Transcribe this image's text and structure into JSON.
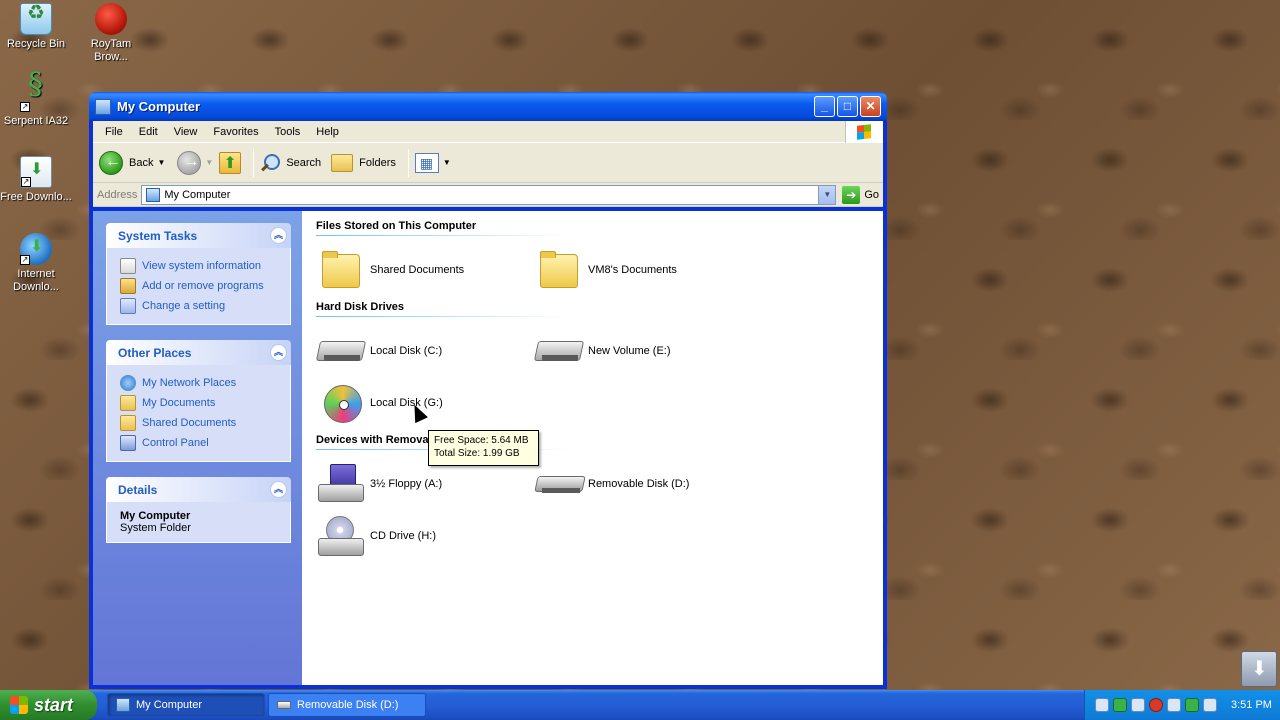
{
  "desktop": {
    "icons": [
      {
        "label": "Recycle Bin",
        "icon": "recycle-bin-icon"
      },
      {
        "label": "RoyTam Brow...",
        "icon": "browser-icon"
      },
      {
        "label": "Serpent IA32",
        "icon": "serpent-icon"
      },
      {
        "label": "Free Downlo...",
        "icon": "download-icon"
      },
      {
        "label": "Internet Downlo...",
        "icon": "download-manager-icon"
      }
    ]
  },
  "window": {
    "title": "My Computer",
    "menu": [
      "File",
      "Edit",
      "View",
      "Favorites",
      "Tools",
      "Help"
    ],
    "toolbar": {
      "back": "Back",
      "search": "Search",
      "folders": "Folders"
    },
    "address": {
      "label": "Address",
      "value": "My Computer",
      "go": "Go"
    }
  },
  "taskpane": {
    "system_tasks": {
      "title": "System Tasks",
      "links": [
        "View system information",
        "Add or remove programs",
        "Change a setting"
      ]
    },
    "other_places": {
      "title": "Other Places",
      "links": [
        "My Network Places",
        "My Documents",
        "Shared Documents",
        "Control Panel"
      ]
    },
    "details": {
      "title": "Details",
      "name": "My Computer",
      "type": "System Folder"
    }
  },
  "main": {
    "groups": [
      {
        "title": "Files Stored on This Computer",
        "items": [
          "Shared Documents",
          "VM8's Documents"
        ]
      },
      {
        "title": "Hard Disk Drives",
        "items": [
          "Local Disk (C:)",
          "New Volume (E:)",
          "Local Disk (G:)"
        ]
      },
      {
        "title": "Devices with Removable Storage",
        "items": [
          "3½ Floppy (A:)",
          "Removable Disk (D:)",
          "CD Drive (H:)"
        ]
      }
    ],
    "tooltip": {
      "free_space": "Free Space: 5.64 MB",
      "total_size": "Total Size: 1.99 GB"
    }
  },
  "taskbar": {
    "start": "start",
    "tasks": [
      "My Computer",
      "Removable Disk (D:)"
    ],
    "clock": "3:51 PM"
  }
}
